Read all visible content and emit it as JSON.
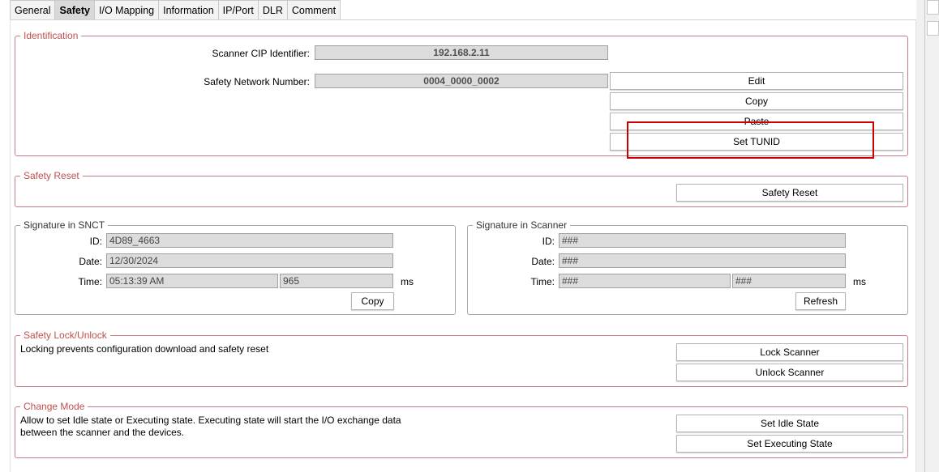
{
  "tabs": [
    "General",
    "Safety",
    "I/O Mapping",
    "Information",
    "IP/Port",
    "DLR",
    "Comment"
  ],
  "identification": {
    "legend": "Identification",
    "cip_label": "Scanner CIP Identifier:",
    "cip_value": "192.168.2.11",
    "snn_label": "Safety Network Number:",
    "snn_value": "0004_0000_0002",
    "edit_label": "Edit",
    "copy_label": "Copy",
    "paste_label": "Paste",
    "set_tunid_label": "Set TUNID"
  },
  "safety_reset": {
    "legend": "Safety Reset",
    "button_label": "Safety Reset"
  },
  "signature_snct": {
    "legend": "Signature in SNCT",
    "id_label": "ID:",
    "id_value": "4D89_4663",
    "date_label": "Date:",
    "date_value": "12/30/2024",
    "time_label": "Time:",
    "time_value": "05:13:39 AM",
    "ms_value": "965",
    "ms_unit": "ms",
    "copy_label": "Copy"
  },
  "signature_scanner": {
    "legend": "Signature in Scanner",
    "id_label": "ID:",
    "id_value": "###",
    "date_label": "Date:",
    "date_value": "###",
    "time_label": "Time:",
    "time_value": "###",
    "ms_value": "###",
    "ms_unit": "ms",
    "refresh_label": "Refresh"
  },
  "safety_lock": {
    "legend": "Safety Lock/Unlock",
    "description": "Locking prevents configuration download and safety reset",
    "lock_label": "Lock Scanner",
    "unlock_label": "Unlock Scanner"
  },
  "change_mode": {
    "legend": "Change Mode",
    "description_line1": "Allow to set Idle state or Executing state. Executing state will start the I/O exchange data",
    "description_line2": "between the scanner and the devices.",
    "idle_label": "Set Idle State",
    "executing_label": "Set Executing State"
  },
  "colors": {
    "group_border": "#c77d86",
    "legend_text": "#c0504d",
    "highlight": "#cc0000",
    "field_bg": "#dcdcdc"
  }
}
